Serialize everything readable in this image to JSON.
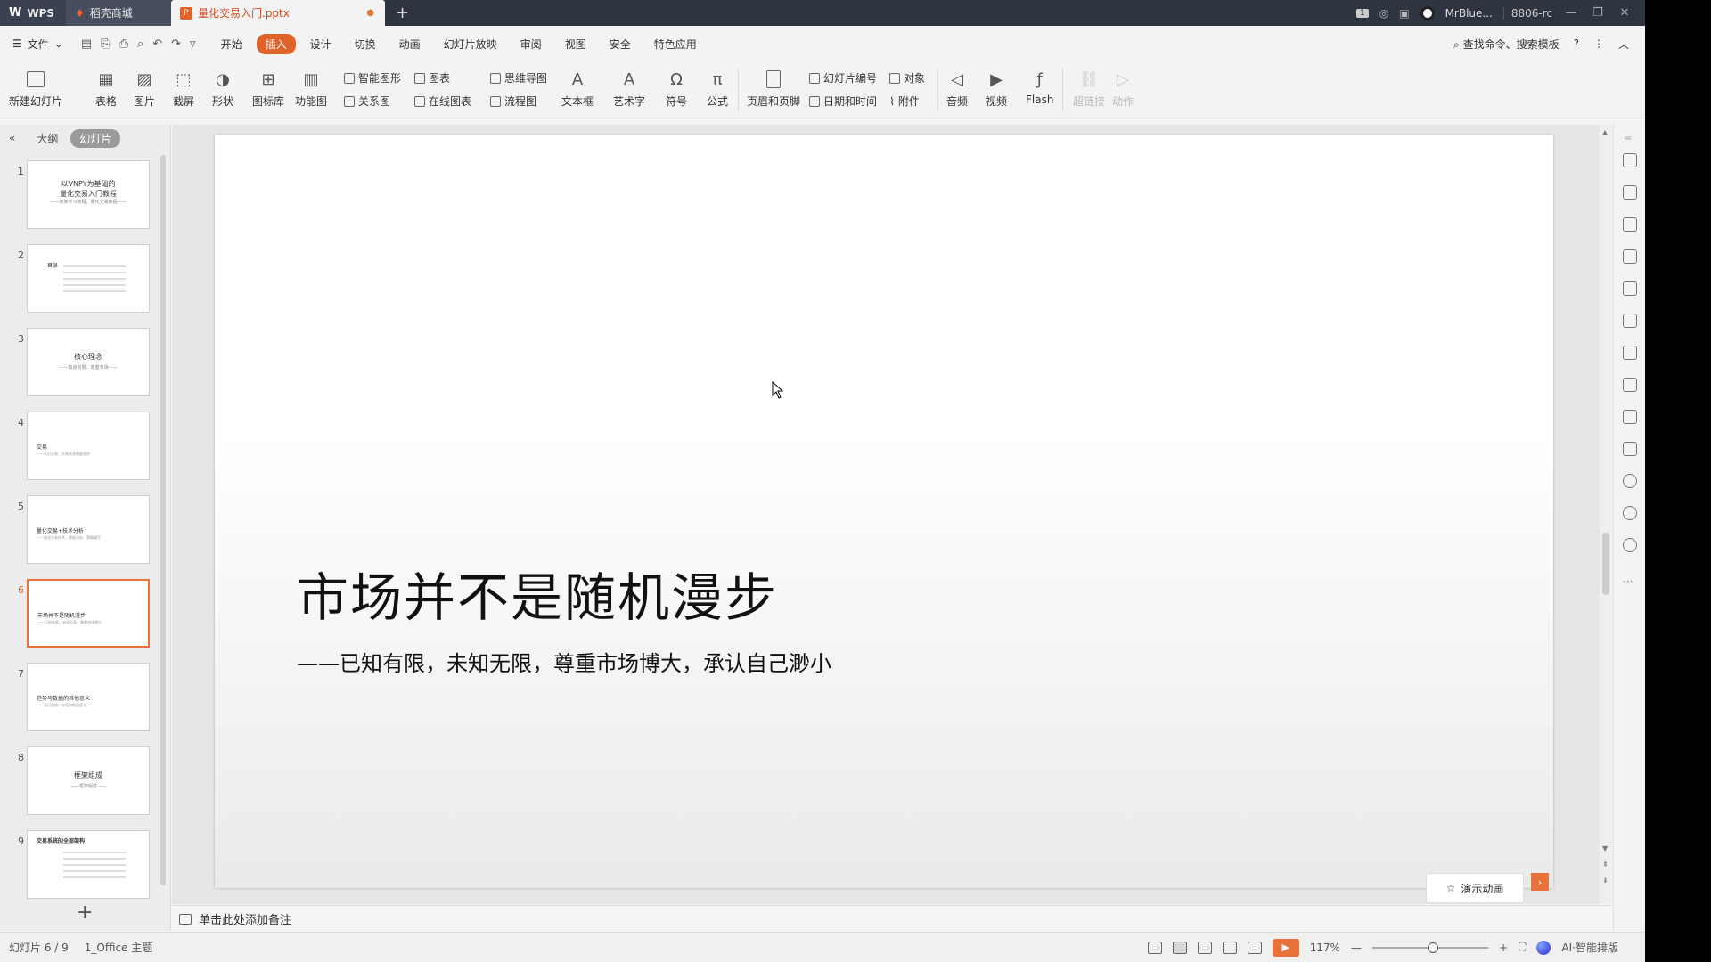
{
  "titlebar": {
    "wps_label": "WPS",
    "shop_label": "稻壳商城",
    "doc_title": "量化交易入门.pptx",
    "user_name": "MrBlue...",
    "user_code": "8806-rc",
    "page_badge": "1"
  },
  "menu": {
    "file_label": "文件",
    "tabs": [
      "开始",
      "插入",
      "设计",
      "切换",
      "动画",
      "幻灯片放映",
      "审阅",
      "视图",
      "安全",
      "特色应用"
    ],
    "active_tab": "插入",
    "search_label": "查找命令、搜索模板",
    "help_label": "?"
  },
  "ribbon": {
    "new_slide": "新建幻灯片",
    "table": "表格",
    "picture": "图片",
    "screenshot": "截屏",
    "shape": "形状",
    "icon_lib": "图标库",
    "function_chart": "功能图",
    "smart_shape": "智能图形",
    "relation_chart": "关系图",
    "chart": "图表",
    "online_chart": "在线图表",
    "mind_map": "思维导图",
    "flowchart": "流程图",
    "textbox": "文本框",
    "art_text": "艺术字",
    "symbol": "符号",
    "formula": "公式",
    "header_footer": "页眉和页脚",
    "slide_number": "幻灯片编号",
    "date_time": "日期和时间",
    "object": "对象",
    "attachment": "附件",
    "audio": "音频",
    "video": "视频",
    "flash": "Flash",
    "hyperlink": "超链接",
    "action": "动作"
  },
  "leftpanel": {
    "outline_tab": "大纲",
    "slides_tab": "幻灯片",
    "slides": [
      {
        "num": "1",
        "title": "以VNPY为基础的\n量化交易入门教程",
        "sub": "——某某学习教程，量化交易教程——"
      },
      {
        "num": "2",
        "title": "目录",
        "sub": ""
      },
      {
        "num": "3",
        "title": "核心理念",
        "sub": "——知道有限，尊重市场——"
      },
      {
        "num": "4",
        "title": "交易",
        "sub": "——认识交易，交易本身需要规则"
      },
      {
        "num": "5",
        "title": "量化交易+技术分析",
        "sub": "——量化交易技术，数据分析，策略编写"
      },
      {
        "num": "6",
        "title": "市场并不是随机漫步",
        "sub": "——已知有限，未知无限，尊重市场博大"
      },
      {
        "num": "7",
        "title": "趋势与数据的其他意义",
        "sub": "——认识趋势，交易的数据意义"
      },
      {
        "num": "8",
        "title": "框架组成",
        "sub": "——框架组成——"
      },
      {
        "num": "9",
        "title": "交易系统的全部架构",
        "sub": ""
      }
    ]
  },
  "slide": {
    "title": "市场并不是随机漫步",
    "subtitle": "——已知有限，未知无限，尊重市场博大，承认自己渺小"
  },
  "canvas": {
    "demo_anim_label": "演示动画",
    "demo_close": "›"
  },
  "notes": {
    "placeholder": "单击此处添加备注"
  },
  "status": {
    "slide_counter": "幻灯片 6 / 9",
    "theme": "1_Office 主题",
    "zoom": "117%",
    "ai_label": "AI·智能排版",
    "zoom_level": 0.52
  },
  "colors": {
    "accent": "#e0632a",
    "titlebar_bg": "#2e3440"
  }
}
